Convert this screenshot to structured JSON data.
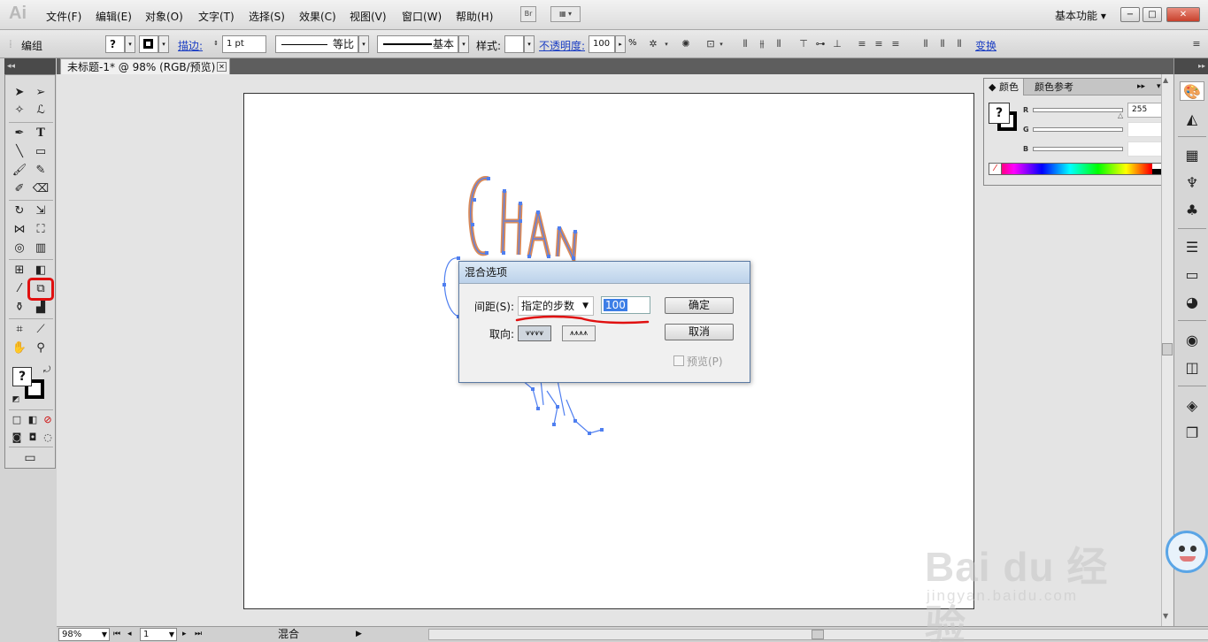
{
  "app": {
    "logo": "Ai",
    "menu": [
      "文件(F)",
      "编辑(E)",
      "对象(O)",
      "文字(T)",
      "选择(S)",
      "效果(C)",
      "视图(V)",
      "窗口(W)",
      "帮助(H)"
    ],
    "bridge_label": "Br",
    "workspace": "基本功能"
  },
  "control_bar": {
    "selection": "编组",
    "stroke_label": "描边:",
    "stroke_weight": "1 pt",
    "stroke_profile": "等比",
    "brush": "基本",
    "style_label": "样式:",
    "opacity_label": "不透明度:",
    "opacity_value": "100",
    "opacity_unit": "%",
    "transform_label": "变换"
  },
  "document": {
    "tab_title": "未标题-1* @ 98% (RGB/预览)"
  },
  "color_panel": {
    "tab_color": "颜色",
    "tab_guide": "颜色参考",
    "channels": [
      {
        "label": "R",
        "value": "255"
      },
      {
        "label": "G",
        "value": ""
      },
      {
        "label": "B",
        "value": ""
      }
    ]
  },
  "blend_dialog": {
    "title": "混合选项",
    "spacing_label": "间距(S):",
    "spacing_mode": "指定的步数",
    "steps_value": "100",
    "ok_label": "确定",
    "cancel_label": "取消",
    "orientation_label": "取向:",
    "preview_label": "预览(P)",
    "preview_checked": false
  },
  "status_bar": {
    "zoom": "98%",
    "page": "1",
    "tool_status": "混合"
  },
  "watermark": {
    "brand": "Bai du 经验",
    "url": "jingyan.baidu.com"
  },
  "colors": {
    "highlight_red": "#e01010",
    "path_blue": "#4f7ff0",
    "art_orange": "#d98a5a"
  }
}
